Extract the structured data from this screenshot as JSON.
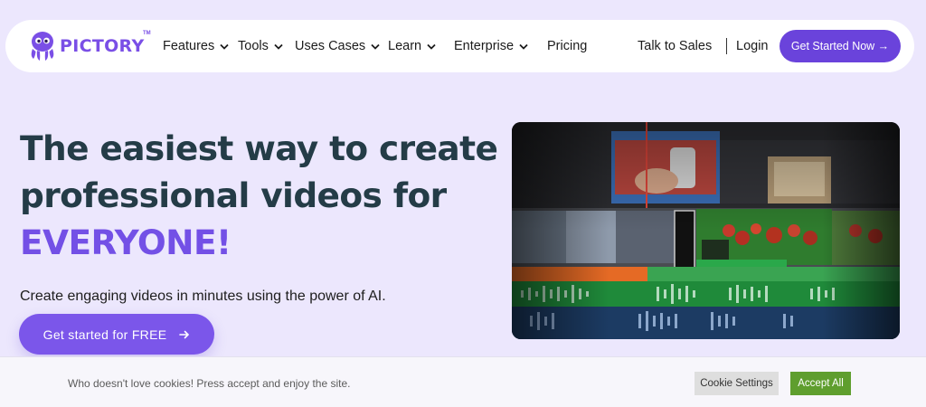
{
  "nav": {
    "logo_text": "PICTORY",
    "logo_tm": "TM",
    "items": [
      {
        "label": "Features"
      },
      {
        "label": "Tools"
      },
      {
        "label": "Uses Cases"
      },
      {
        "label": "Learn"
      },
      {
        "label": "Enterprise"
      },
      {
        "label": "Pricing"
      }
    ],
    "talk_to_sales": "Talk to Sales",
    "divider": "|",
    "login": "Login",
    "cta": "Get Started Now →"
  },
  "hero": {
    "title_line1": "The easiest way to create",
    "title_line2": "professional videos for",
    "title_accent": "EVERYONE!",
    "subtitle": "Create engaging videos in minutes using the power of AI.",
    "cta": "Get started for FREE"
  },
  "cookie": {
    "message": "Who doesn't love cookies! Press accept and enjoy the site.",
    "settings": "Cookie Settings",
    "accept": "Accept All"
  },
  "colors": {
    "page_bg": "#ece7fd",
    "brand_purple": "#6a43db",
    "accent_text": "#7350e6",
    "accept_green": "#5f9e2e"
  }
}
